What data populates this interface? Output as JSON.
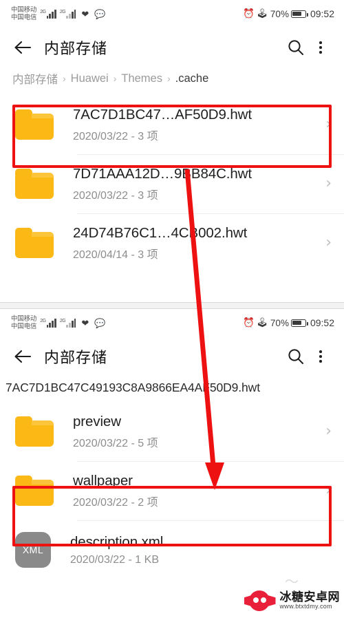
{
  "status_bar": {
    "carrier_primary": "中国移动",
    "carrier_secondary": "中国电信",
    "network_label_1": "2G",
    "network_label_2": "2G",
    "alarm_icon": "alarm-clock-icon",
    "bluetooth_icon": "bluetooth-icon",
    "battery_text": "70%",
    "time": "09:52"
  },
  "screen_one": {
    "app_bar": {
      "back_icon": "back-arrow-icon",
      "title": "内部存储",
      "search_icon": "search-icon",
      "overflow_icon": "more-vertical-icon"
    },
    "breadcrumb": {
      "root": "内部存储",
      "level_1": "Huawei",
      "level_2": "Themes",
      "current": ".cache",
      "separator": "›"
    },
    "files": [
      {
        "name": "7AC7D1BC47…AF50D9.hwt",
        "sub": "2020/03/22 - 3 项",
        "icon": "folder-icon",
        "chevron": "›",
        "highlighted": true
      },
      {
        "name": "7D71AAA12D…9BB84C.hwt",
        "sub": "2020/03/22 - 3 项",
        "icon": "folder-icon",
        "chevron": "›",
        "highlighted": false
      },
      {
        "name": "24D74B76C1…4CB002.hwt",
        "sub": "2020/04/14 - 3 项",
        "icon": "folder-icon",
        "chevron": "›",
        "highlighted": false
      }
    ]
  },
  "screen_two": {
    "app_bar": {
      "back_icon": "back-arrow-icon",
      "title": "内部存储",
      "search_icon": "search-icon",
      "overflow_icon": "more-vertical-icon"
    },
    "breadcrumb_path": "7AC7D1BC47C49193C8A9866EA4AF50D9.hwt",
    "files": [
      {
        "name": "preview",
        "sub": "2020/03/22 - 5 项",
        "icon": "folder-icon",
        "chevron": "›",
        "highlighted": false
      },
      {
        "name": "wallpaper",
        "sub": "2020/03/22 - 2 项",
        "icon": "folder-icon",
        "chevron": "›",
        "highlighted": true
      },
      {
        "name": "description.xml",
        "sub": "2020/03/22 - 1 KB",
        "icon": "xml-file-icon",
        "icon_label": "XML",
        "chevron": "",
        "highlighted": false
      }
    ]
  },
  "annotations": {
    "highlight_color": "#ee1111",
    "arrow_color": "#ee1111",
    "arrow_from": "first file row in .cache",
    "arrow_to": "wallpaper folder row"
  },
  "watermark": {
    "site_name": "冰糖安卓网",
    "site_url": "www.btxtdmy.com"
  }
}
